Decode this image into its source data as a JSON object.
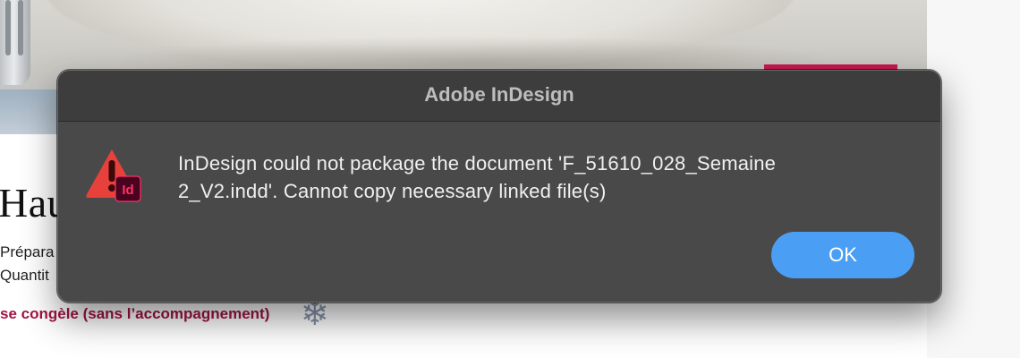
{
  "background_document": {
    "heading": "Hau",
    "line_1": "Prépara",
    "line_2": "Quantit",
    "freeze_note": "se congèle (sans l’accompagnement)",
    "snowflake_glyph": "❄"
  },
  "dialog": {
    "title": "Adobe InDesign",
    "message_line_1": "InDesign could not package the document 'F_51610_028_Semaine",
    "message_line_2": "2_V2.indd'. Cannot copy necessary linked file(s)",
    "icon_badge": "Id",
    "ok_label": "OK"
  },
  "colors": {
    "dialog_bg": "#494949",
    "warning_red": "#e8413c",
    "indesign_badge": "#49021f",
    "indesign_pink": "#ff3366",
    "ok_button": "#4a9ff5",
    "freeze_text": "#a01446"
  }
}
